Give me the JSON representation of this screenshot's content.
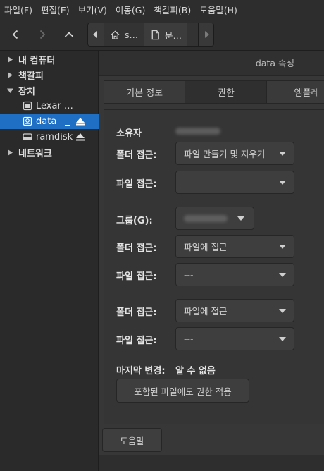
{
  "menu": [
    "파일(F)",
    "편집(E)",
    "보기(V)",
    "이동(G)",
    "책갈피(B)",
    "도움말(H)"
  ],
  "path": {
    "home": "s…",
    "current": "문…"
  },
  "sidebar": {
    "computer": "내 컴퓨터",
    "bookmarks": "책갈피",
    "devices": "장치",
    "lexar": "Lexar …",
    "data": "data",
    "ramdisk": "ramdisk",
    "network": "네트워크"
  },
  "dialog": {
    "title": "data 속성",
    "tabs": [
      "기본 정보",
      "권한",
      "엠플레"
    ],
    "owner_label": "소유자",
    "owner_folder_label": "폴더 접근:",
    "owner_folder_value": "파일 만들기 및 지우기",
    "owner_file_label": "파일 접근:",
    "owner_file_value": "---",
    "group_label": "그룹(G):",
    "group_folder_label": "폴더 접근:",
    "group_folder_value": "파일에 접근",
    "group_file_label": "파일 접근:",
    "group_file_value": "---",
    "other_folder_label": "폴더 접근:",
    "other_folder_value": "파일에 접근",
    "other_file_label": "파일 접근:",
    "other_file_value": "---",
    "modified_label": "마지막 변경:",
    "modified_value": "알 수 없음",
    "apply_button": "포함된 파일에도 권한 적용",
    "help_button": "도움말"
  },
  "colors": {
    "selection": "#1f6fc5",
    "background": "#2b2b2b"
  }
}
